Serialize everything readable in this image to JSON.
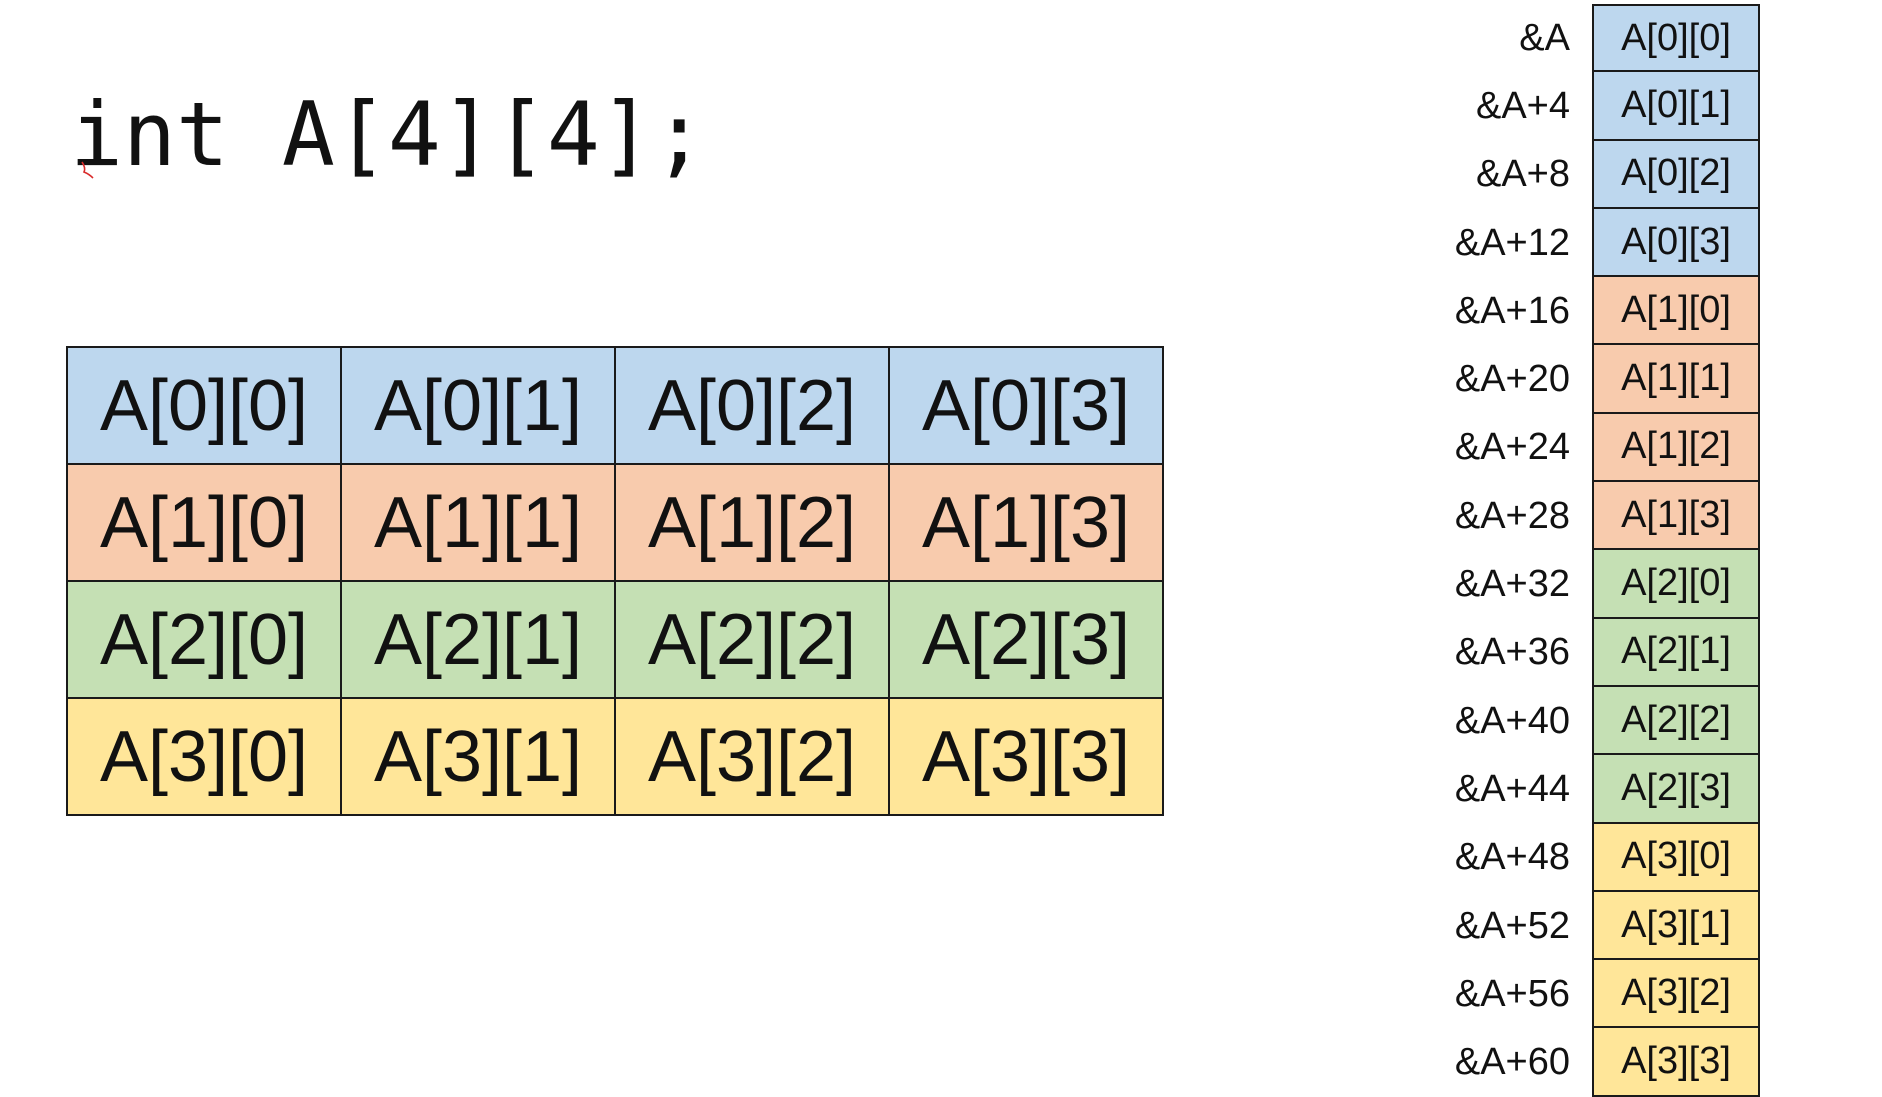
{
  "declaration": "int A[4][4];",
  "row_colors": [
    "#bdd7ee",
    "#f8cbad",
    "#c5e0b4",
    "#ffe699"
  ],
  "grid": {
    "rows": [
      [
        "A[0][0]",
        "A[0][1]",
        "A[0][2]",
        "A[0][3]"
      ],
      [
        "A[1][0]",
        "A[1][1]",
        "A[1][2]",
        "A[1][3]"
      ],
      [
        "A[2][0]",
        "A[2][1]",
        "A[2][2]",
        "A[2][3]"
      ],
      [
        "A[3][0]",
        "A[3][1]",
        "A[3][2]",
        "A[3][3]"
      ]
    ]
  },
  "memory": [
    {
      "address": "&A",
      "element": "A[0][0]",
      "row": 0
    },
    {
      "address": "&A+4",
      "element": "A[0][1]",
      "row": 0
    },
    {
      "address": "&A+8",
      "element": "A[0][2]",
      "row": 0
    },
    {
      "address": "&A+12",
      "element": "A[0][3]",
      "row": 0
    },
    {
      "address": "&A+16",
      "element": "A[1][0]",
      "row": 1
    },
    {
      "address": "&A+20",
      "element": "A[1][1]",
      "row": 1
    },
    {
      "address": "&A+24",
      "element": "A[1][2]",
      "row": 1
    },
    {
      "address": "&A+28",
      "element": "A[1][3]",
      "row": 1
    },
    {
      "address": "&A+32",
      "element": "A[2][0]",
      "row": 2
    },
    {
      "address": "&A+36",
      "element": "A[2][1]",
      "row": 2
    },
    {
      "address": "&A+40",
      "element": "A[2][2]",
      "row": 2
    },
    {
      "address": "&A+44",
      "element": "A[2][3]",
      "row": 2
    },
    {
      "address": "&A+48",
      "element": "A[3][0]",
      "row": 3
    },
    {
      "address": "&A+52",
      "element": "A[3][1]",
      "row": 3
    },
    {
      "address": "&A+56",
      "element": "A[3][2]",
      "row": 3
    },
    {
      "address": "&A+60",
      "element": "A[3][3]",
      "row": 3
    }
  ]
}
